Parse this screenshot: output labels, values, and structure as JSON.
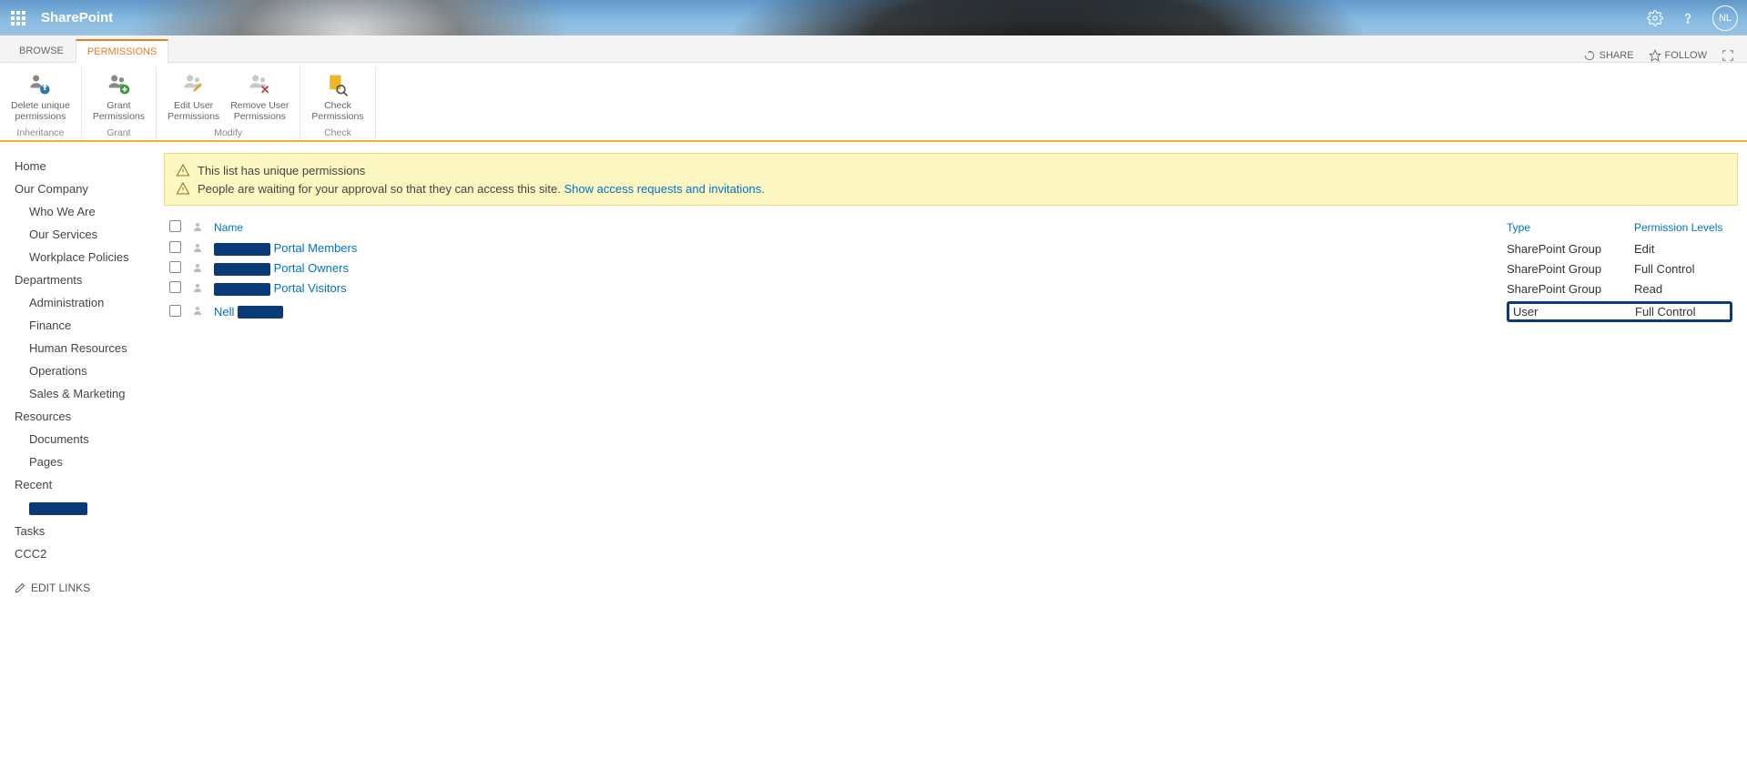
{
  "suite": {
    "brand": "SharePoint",
    "userInitials": "NL"
  },
  "ribbonTabs": {
    "browse": "BROWSE",
    "permissions": "PERMISSIONS"
  },
  "ribbonTopActions": {
    "share": "SHARE",
    "follow": "FOLLOW"
  },
  "ribbon": {
    "deleteUnique": {
      "line1": "Delete unique",
      "line2": "permissions"
    },
    "grant": {
      "line1": "Grant",
      "line2": "Permissions"
    },
    "editUser": {
      "line1": "Edit User",
      "line2": "Permissions"
    },
    "removeUser": {
      "line1": "Remove User",
      "line2": "Permissions"
    },
    "check": {
      "line1": "Check",
      "line2": "Permissions"
    },
    "groupInheritance": "Inheritance",
    "groupGrant": "Grant",
    "groupModify": "Modify",
    "groupCheck": "Check"
  },
  "nav": {
    "home": "Home",
    "ourCompany": "Our Company",
    "whoWeAre": "Who We Are",
    "ourServices": "Our Services",
    "workplacePolicies": "Workplace Policies",
    "departments": "Departments",
    "administration": "Administration",
    "finance": "Finance",
    "humanResources": "Human Resources",
    "operations": "Operations",
    "salesMarketing": "Sales & Marketing",
    "resources": "Resources",
    "documents": "Documents",
    "pages": "Pages",
    "recent": "Recent",
    "tasks": "Tasks",
    "ccc2": "CCC2",
    "editLinks": "EDIT LINKS"
  },
  "notifications": {
    "unique": "This list has unique permissions",
    "approvalPrefix": "People are waiting for your approval so that they can access this site. ",
    "approvalLink": "Show access requests and invitations."
  },
  "tableHeaders": {
    "name": "Name",
    "type": "Type",
    "level": "Permission Levels"
  },
  "rows": [
    {
      "prefixRedacted": true,
      "nameSuffix": "Portal Members",
      "type": "SharePoint Group",
      "level": "Edit",
      "highlight": false
    },
    {
      "prefixRedacted": true,
      "nameSuffix": "Portal Owners",
      "type": "SharePoint Group",
      "level": "Full Control",
      "highlight": false
    },
    {
      "prefixRedacted": true,
      "nameSuffix": "Portal Visitors",
      "type": "SharePoint Group",
      "level": "Read",
      "highlight": false
    },
    {
      "prefixRedacted": false,
      "namePrefix": "Nell",
      "suffixRedacted": true,
      "type": "User",
      "level": "Full Control",
      "highlight": true
    }
  ]
}
